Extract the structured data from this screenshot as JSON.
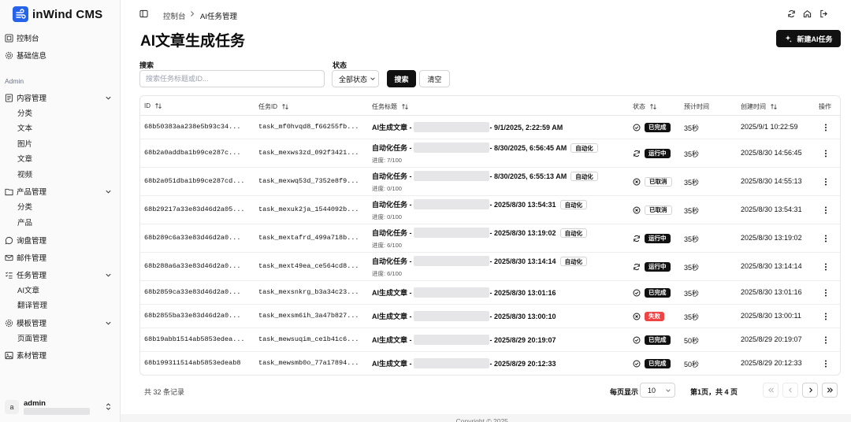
{
  "app": {
    "name": "inWind CMS"
  },
  "sidebar": {
    "top_items": [
      {
        "label": "控制台",
        "icon": "dashboard-icon"
      },
      {
        "label": "基础信息",
        "icon": "gear-icon"
      }
    ],
    "section_label": "Admin",
    "groups": [
      {
        "label": "内容管理",
        "icon": "content-icon",
        "children": [
          "分类",
          "文本",
          "图片",
          "文章",
          "视频"
        ]
      },
      {
        "label": "产品管理",
        "icon": "product-icon",
        "children": [
          "分类",
          "产品"
        ]
      },
      {
        "label": "询盘管理",
        "icon": "chat-icon",
        "children": []
      },
      {
        "label": "邮件管理",
        "icon": "mail-icon",
        "children": []
      },
      {
        "label": "任务管理",
        "icon": "task-list-icon",
        "children": [
          "AI文章",
          "翻译管理"
        ]
      },
      {
        "label": "模板管理",
        "icon": "template-icon",
        "children": [
          "页面管理"
        ]
      },
      {
        "label": "素材管理",
        "icon": "image-icon",
        "children": []
      }
    ],
    "user": {
      "avatar": "a",
      "name": "admin"
    }
  },
  "breadcrumb": [
    "控制台",
    "AI任务管理"
  ],
  "page": {
    "title": "AI文章生成任务",
    "new_button": "新建AI任务"
  },
  "filters": {
    "search_label": "搜索",
    "search_placeholder": "搜索任务标题或ID...",
    "status_label": "状态",
    "status_value": "全部状态",
    "search_button": "搜索",
    "clear_button": "清空"
  },
  "table": {
    "columns": [
      "ID",
      "任务ID",
      "任务标题",
      "状态",
      "预计时间",
      "创建时间",
      "操作"
    ],
    "rows": [
      {
        "id": "68b50383aa238e5b93c34...",
        "task_id": "task_mf0hvqd8_f66255fb...",
        "title_prefix": "AI生成文章 - ",
        "title_suffix": "- 9/1/2025, 2:22:59 AM",
        "auto": "",
        "progress": "",
        "status": "已完成",
        "status_kind": "done",
        "eta": "35秒",
        "created": "2025/9/1 10:22:59"
      },
      {
        "id": "68b2a0addba1b99ce287c...",
        "task_id": "task_mexws3zd_092f3421...",
        "title_prefix": "自动化任务 - ",
        "title_suffix": "- 8/30/2025, 6:56:45 AM",
        "auto": "自动化",
        "progress": "进度: 7/100",
        "status": "运行中",
        "status_kind": "running",
        "eta": "35秒",
        "created": "2025/8/30 14:56:45"
      },
      {
        "id": "68b2a051dba1b99ce287cd...",
        "task_id": "task_mexwq53d_7352e8f9...",
        "title_prefix": "自动化任务 - ",
        "title_suffix": "- 8/30/2025, 6:55:13 AM",
        "auto": "自动化",
        "progress": "进度: 0/100",
        "status": "已取消",
        "status_kind": "cancelled",
        "eta": "35秒",
        "created": "2025/8/30 14:55:13"
      },
      {
        "id": "68b29217a33e83d46d2a05...",
        "task_id": "task_mexuk2ja_1544092b...",
        "title_prefix": "自动化任务 - ",
        "title_suffix": "- 2025/8/30 13:54:31",
        "auto": "自动化",
        "progress": "进度: 0/100",
        "status": "已取消",
        "status_kind": "cancelled",
        "eta": "35秒",
        "created": "2025/8/30 13:54:31"
      },
      {
        "id": "68b289c6a33e83d46d2a0...",
        "task_id": "task_mextafrd_499a718b...",
        "title_prefix": "自动化任务 - ",
        "title_suffix": "- 2025/8/30 13:19:02",
        "auto": "自动化",
        "progress": "进度: 6/100",
        "status": "运行中",
        "status_kind": "running",
        "eta": "35秒",
        "created": "2025/8/30 13:19:02"
      },
      {
        "id": "68b288a6a33e83d46d2a0...",
        "task_id": "task_mext49ea_ce564cd8...",
        "title_prefix": "自动化任务 - ",
        "title_suffix": "- 2025/8/30 13:14:14",
        "auto": "自动化",
        "progress": "进度: 6/100",
        "status": "运行中",
        "status_kind": "running",
        "eta": "35秒",
        "created": "2025/8/30 13:14:14"
      },
      {
        "id": "68b2859ca33e83d46d2a0...",
        "task_id": "task_mexsnkrg_b3a34c23...",
        "title_prefix": "AI生成文章 - ",
        "title_suffix": "- 2025/8/30 13:01:16",
        "auto": "",
        "progress": "",
        "status": "已完成",
        "status_kind": "done",
        "eta": "35秒",
        "created": "2025/8/30 13:01:16"
      },
      {
        "id": "68b2855ba33e83d46d2a0...",
        "task_id": "task_mexsm6ih_3a47b827...",
        "title_prefix": "AI生成文章 - ",
        "title_suffix": "- 2025/8/30 13:00:10",
        "auto": "",
        "progress": "",
        "status": "失败",
        "status_kind": "failed",
        "eta": "35秒",
        "created": "2025/8/30 13:00:11"
      },
      {
        "id": "68b19abb1514ab5853edea...",
        "task_id": "task_mewsuqim_ce1b41c6...",
        "title_prefix": "AI生成文章 - ",
        "title_suffix": "- 2025/8/29 20:19:07",
        "auto": "",
        "progress": "",
        "status": "已完成",
        "status_kind": "done",
        "eta": "50秒",
        "created": "2025/8/29 20:19:07"
      },
      {
        "id": "68b199311514ab5853edeab8",
        "task_id": "task_mewsmb0o_77a17894...",
        "title_prefix": "AI生成文章 - ",
        "title_suffix": "- 2025/8/29 20:12:33",
        "auto": "",
        "progress": "",
        "status": "已完成",
        "status_kind": "done",
        "eta": "50秒",
        "created": "2025/8/29 20:12:33"
      }
    ]
  },
  "footer": {
    "total": "共 32 条记录",
    "per_page_label": "每页显示",
    "per_page_value": "10",
    "page_info": "第1页，共 4 页",
    "copyright": "Copyright © 2025 ..."
  },
  "colors": {
    "accent": "#111111",
    "logo_blue": "#2563eb",
    "failed": "#ef4444"
  }
}
